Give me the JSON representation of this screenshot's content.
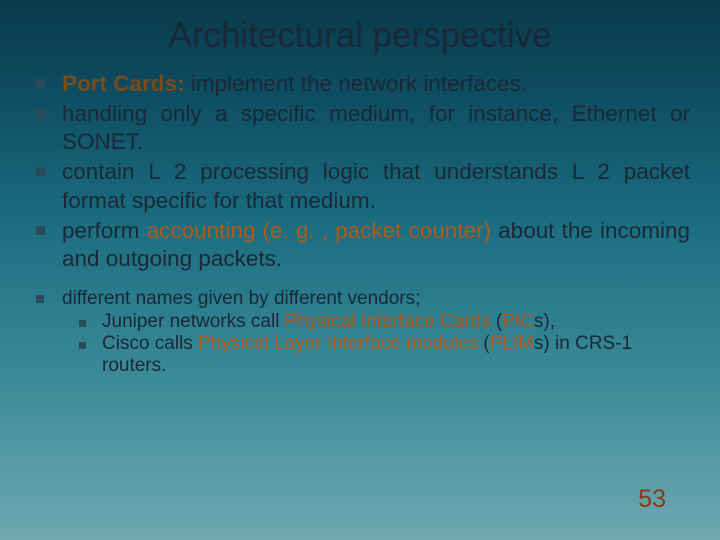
{
  "slide": {
    "title": "Architectural perspective",
    "bullets": [
      {
        "lead": "Port Cards:",
        "rest": " implement the network interfaces."
      },
      {
        "text": "handling only a specific medium, for instance, Ethernet or SONET."
      },
      {
        "text_before": "contain L 2 processing logic that understands L 2 packet format specific for that medium."
      },
      {
        "pre": "perform ",
        "hl": "accounting (e. g. , packet counter)",
        "post": " about the incoming and outgoing packets."
      }
    ],
    "sub": {
      "lead": "different names given by different vendors;",
      "nested": [
        {
          "pre": "Juniper networks call ",
          "hl1": "Physical Interface Cards",
          "mid": " (",
          "hl2": "PIC",
          "post": "s),"
        },
        {
          "pre": "Cisco calls ",
          "hl1": "Physical Layer Interface modules",
          "mid": " (",
          "hl2": "PLIM",
          "post": "s) in CRS-1 routers."
        }
      ]
    },
    "page": "53"
  }
}
